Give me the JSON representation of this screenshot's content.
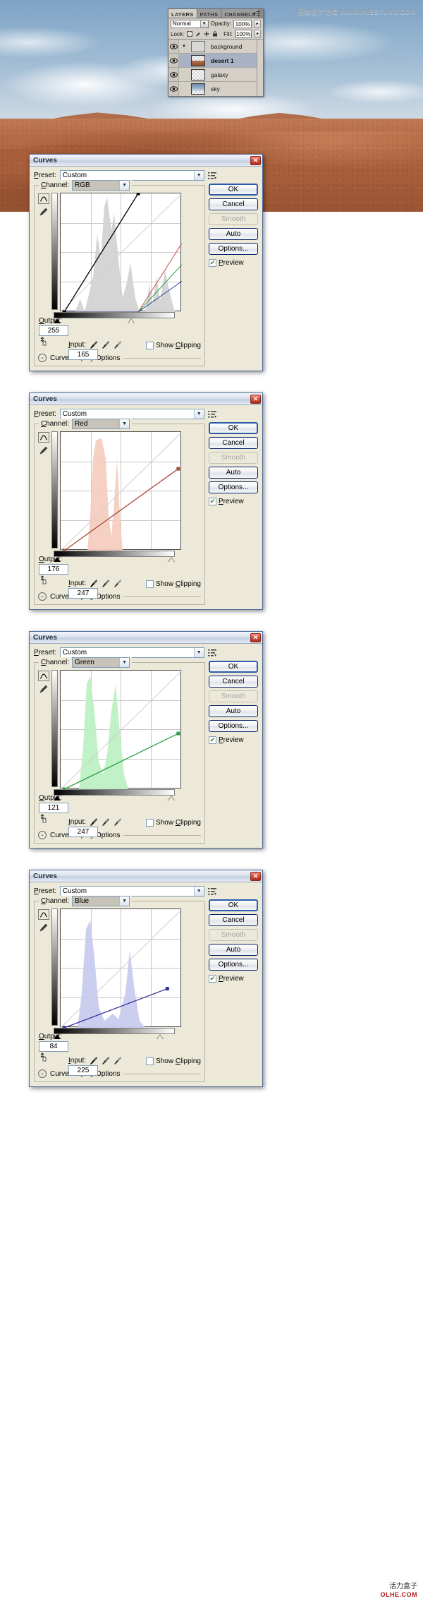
{
  "photo": {
    "watermark_top": "思缘设计论坛 WWW.MISSYUAN.COM",
    "alt": "desert dunes under cloudy sky"
  },
  "layers_panel": {
    "tabs": [
      {
        "label": "LAYERS",
        "active": true
      },
      {
        "label": "PATHS",
        "active": false
      },
      {
        "label": "CHANNELS",
        "active": false
      }
    ],
    "menu_icon": "panel-menu-icon",
    "blend_mode": "Normal",
    "opacity_label": "Opacity:",
    "opacity_value": "100%",
    "lock_label": "Lock:",
    "lock_icons": [
      "lock-transparent-icon",
      "lock-image-icon",
      "lock-position-icon",
      "lock-all-icon"
    ],
    "fill_label": "Fill:",
    "fill_value": "100%",
    "layers": [
      {
        "name": "background",
        "type": "group",
        "visible": true,
        "selected": false,
        "expanded": true
      },
      {
        "name": "desert 1",
        "type": "image",
        "visible": true,
        "selected": true,
        "expanded": false
      },
      {
        "name": "galaxy",
        "type": "image",
        "visible": true,
        "selected": false,
        "expanded": false
      },
      {
        "name": "sky",
        "type": "image",
        "visible": true,
        "selected": false,
        "expanded": false
      }
    ]
  },
  "common": {
    "title": "Curves",
    "close_icon": "close-icon",
    "preset_label": "Preset:",
    "preset_value": "Custom",
    "preset_menu_icon": "preset-menu-icon",
    "channel_label": "Channel:",
    "curve_tool_icon": "curve-draw-icon",
    "pencil_tool_icon": "pencil-draw-icon",
    "output_label": "Output:",
    "input_label": "Input:",
    "hand_icon": "target-adjust-icon",
    "eyedropper_icons": [
      "eyedropper-black-icon",
      "eyedropper-gray-icon",
      "eyedropper-white-icon"
    ],
    "show_clipping_label": "Show Clipping",
    "show_clipping_checked": false,
    "curve_display_options_label": "Curve Display Options",
    "expand_icon": "chevron-down-circle-icon",
    "buttons": {
      "ok": "OK",
      "cancel": "Cancel",
      "smooth": "Smooth",
      "auto": "Auto",
      "options": "Options...",
      "preview": "Preview"
    },
    "preview_checked": true,
    "smooth_disabled": true
  },
  "dialogs": [
    {
      "id": "rgb",
      "channel": "RGB",
      "output": "255",
      "input": "165",
      "curve_color": "#000000",
      "histogram_color": "#d3d3d3",
      "extra_curves": [
        {
          "name": "red-curve",
          "color": "#c0504d"
        },
        {
          "name": "green-curve",
          "color": "#2f9e44"
        },
        {
          "name": "blue-curve",
          "color": "#2b3a8f"
        }
      ],
      "black_marker_pct": 3,
      "white_marker_pct": 64,
      "points": [
        [
          3,
          0
        ],
        [
          64,
          100
        ]
      ]
    },
    {
      "id": "red",
      "channel": "Red",
      "output": "176",
      "input": "247",
      "curve_color": "#a94d3a",
      "histogram_color": "#f6cdc0",
      "extra_curves": [],
      "black_marker_pct": 3,
      "white_marker_pct": 97,
      "points": [
        [
          3,
          0
        ],
        [
          97,
          69
        ]
      ]
    },
    {
      "id": "green",
      "channel": "Green",
      "output": "121",
      "input": "247",
      "curve_color": "#2f9e44",
      "histogram_color": "#bdf0c4",
      "extra_curves": [],
      "black_marker_pct": 3,
      "white_marker_pct": 97,
      "points": [
        [
          3,
          0
        ],
        [
          97,
          47
        ]
      ]
    },
    {
      "id": "blue",
      "channel": "Blue",
      "output": "84",
      "input": "225",
      "curve_color": "#30309a",
      "histogram_color": "#c9cbef",
      "extra_curves": [],
      "black_marker_pct": 3,
      "white_marker_pct": 88,
      "points": [
        [
          3,
          0
        ],
        [
          88,
          33
        ]
      ]
    }
  ],
  "footer_watermark": {
    "cn": "活力盒子",
    "en": "OLHE.COM"
  }
}
